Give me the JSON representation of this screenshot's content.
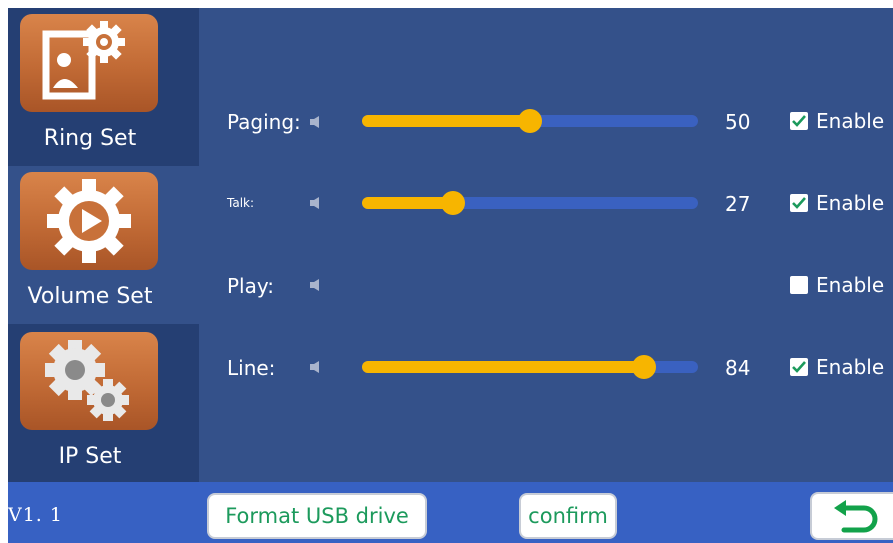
{
  "sidebar": {
    "items": [
      {
        "label": "Ring Set",
        "icon": "ring-settings-icon",
        "active": true
      },
      {
        "label": "Volume Set",
        "icon": "play-gear-icon",
        "active": false
      },
      {
        "label": "IP Set",
        "icon": "gears-icon",
        "active": false
      }
    ]
  },
  "settings": {
    "rows": [
      {
        "label": "Paging:",
        "value": "50",
        "level": 50,
        "enabled": true,
        "enable_label": "Enable"
      },
      {
        "label": "Talk:",
        "value": "27",
        "level": 27,
        "enabled": true,
        "enable_label": "Enable"
      },
      {
        "label": "Play:",
        "enabled": false,
        "enable_label": "Enable"
      },
      {
        "label": "Line:",
        "value": "84",
        "level": 84,
        "enabled": true,
        "enable_label": "Enable"
      }
    ]
  },
  "bottom": {
    "version": "V1. 1",
    "format_button": "Format USB drive",
    "confirm_button": "confirm",
    "back_icon": "back-arrow-icon"
  },
  "colors": {
    "background": "#34518a",
    "sidebar_inactive": "#253f73",
    "bottom_bar": "#3761c3",
    "slider_fill": "#f7b500",
    "slider_track": "#3a61c0",
    "tile": "#c16a35",
    "button_text": "#1c9a5c"
  }
}
